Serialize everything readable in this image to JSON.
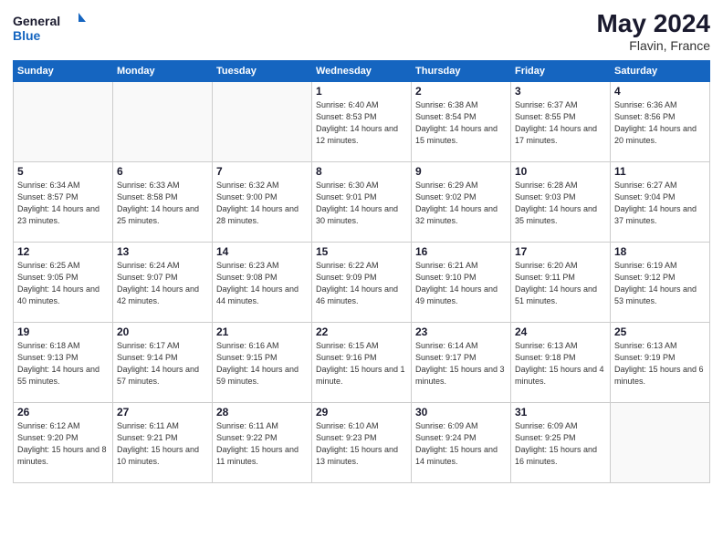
{
  "header": {
    "logo_general": "General",
    "logo_blue": "Blue",
    "month_year": "May 2024",
    "location": "Flavin, France"
  },
  "days_of_week": [
    "Sunday",
    "Monday",
    "Tuesday",
    "Wednesday",
    "Thursday",
    "Friday",
    "Saturday"
  ],
  "weeks": [
    [
      {
        "day": "",
        "info": ""
      },
      {
        "day": "",
        "info": ""
      },
      {
        "day": "",
        "info": ""
      },
      {
        "day": "1",
        "info": "Sunrise: 6:40 AM\nSunset: 8:53 PM\nDaylight: 14 hours\nand 12 minutes."
      },
      {
        "day": "2",
        "info": "Sunrise: 6:38 AM\nSunset: 8:54 PM\nDaylight: 14 hours\nand 15 minutes."
      },
      {
        "day": "3",
        "info": "Sunrise: 6:37 AM\nSunset: 8:55 PM\nDaylight: 14 hours\nand 17 minutes."
      },
      {
        "day": "4",
        "info": "Sunrise: 6:36 AM\nSunset: 8:56 PM\nDaylight: 14 hours\nand 20 minutes."
      }
    ],
    [
      {
        "day": "5",
        "info": "Sunrise: 6:34 AM\nSunset: 8:57 PM\nDaylight: 14 hours\nand 23 minutes."
      },
      {
        "day": "6",
        "info": "Sunrise: 6:33 AM\nSunset: 8:58 PM\nDaylight: 14 hours\nand 25 minutes."
      },
      {
        "day": "7",
        "info": "Sunrise: 6:32 AM\nSunset: 9:00 PM\nDaylight: 14 hours\nand 28 minutes."
      },
      {
        "day": "8",
        "info": "Sunrise: 6:30 AM\nSunset: 9:01 PM\nDaylight: 14 hours\nand 30 minutes."
      },
      {
        "day": "9",
        "info": "Sunrise: 6:29 AM\nSunset: 9:02 PM\nDaylight: 14 hours\nand 32 minutes."
      },
      {
        "day": "10",
        "info": "Sunrise: 6:28 AM\nSunset: 9:03 PM\nDaylight: 14 hours\nand 35 minutes."
      },
      {
        "day": "11",
        "info": "Sunrise: 6:27 AM\nSunset: 9:04 PM\nDaylight: 14 hours\nand 37 minutes."
      }
    ],
    [
      {
        "day": "12",
        "info": "Sunrise: 6:25 AM\nSunset: 9:05 PM\nDaylight: 14 hours\nand 40 minutes."
      },
      {
        "day": "13",
        "info": "Sunrise: 6:24 AM\nSunset: 9:07 PM\nDaylight: 14 hours\nand 42 minutes."
      },
      {
        "day": "14",
        "info": "Sunrise: 6:23 AM\nSunset: 9:08 PM\nDaylight: 14 hours\nand 44 minutes."
      },
      {
        "day": "15",
        "info": "Sunrise: 6:22 AM\nSunset: 9:09 PM\nDaylight: 14 hours\nand 46 minutes."
      },
      {
        "day": "16",
        "info": "Sunrise: 6:21 AM\nSunset: 9:10 PM\nDaylight: 14 hours\nand 49 minutes."
      },
      {
        "day": "17",
        "info": "Sunrise: 6:20 AM\nSunset: 9:11 PM\nDaylight: 14 hours\nand 51 minutes."
      },
      {
        "day": "18",
        "info": "Sunrise: 6:19 AM\nSunset: 9:12 PM\nDaylight: 14 hours\nand 53 minutes."
      }
    ],
    [
      {
        "day": "19",
        "info": "Sunrise: 6:18 AM\nSunset: 9:13 PM\nDaylight: 14 hours\nand 55 minutes."
      },
      {
        "day": "20",
        "info": "Sunrise: 6:17 AM\nSunset: 9:14 PM\nDaylight: 14 hours\nand 57 minutes."
      },
      {
        "day": "21",
        "info": "Sunrise: 6:16 AM\nSunset: 9:15 PM\nDaylight: 14 hours\nand 59 minutes."
      },
      {
        "day": "22",
        "info": "Sunrise: 6:15 AM\nSunset: 9:16 PM\nDaylight: 15 hours\nand 1 minute."
      },
      {
        "day": "23",
        "info": "Sunrise: 6:14 AM\nSunset: 9:17 PM\nDaylight: 15 hours\nand 3 minutes."
      },
      {
        "day": "24",
        "info": "Sunrise: 6:13 AM\nSunset: 9:18 PM\nDaylight: 15 hours\nand 4 minutes."
      },
      {
        "day": "25",
        "info": "Sunrise: 6:13 AM\nSunset: 9:19 PM\nDaylight: 15 hours\nand 6 minutes."
      }
    ],
    [
      {
        "day": "26",
        "info": "Sunrise: 6:12 AM\nSunset: 9:20 PM\nDaylight: 15 hours\nand 8 minutes."
      },
      {
        "day": "27",
        "info": "Sunrise: 6:11 AM\nSunset: 9:21 PM\nDaylight: 15 hours\nand 10 minutes."
      },
      {
        "day": "28",
        "info": "Sunrise: 6:11 AM\nSunset: 9:22 PM\nDaylight: 15 hours\nand 11 minutes."
      },
      {
        "day": "29",
        "info": "Sunrise: 6:10 AM\nSunset: 9:23 PM\nDaylight: 15 hours\nand 13 minutes."
      },
      {
        "day": "30",
        "info": "Sunrise: 6:09 AM\nSunset: 9:24 PM\nDaylight: 15 hours\nand 14 minutes."
      },
      {
        "day": "31",
        "info": "Sunrise: 6:09 AM\nSunset: 9:25 PM\nDaylight: 15 hours\nand 16 minutes."
      },
      {
        "day": "",
        "info": ""
      }
    ]
  ]
}
